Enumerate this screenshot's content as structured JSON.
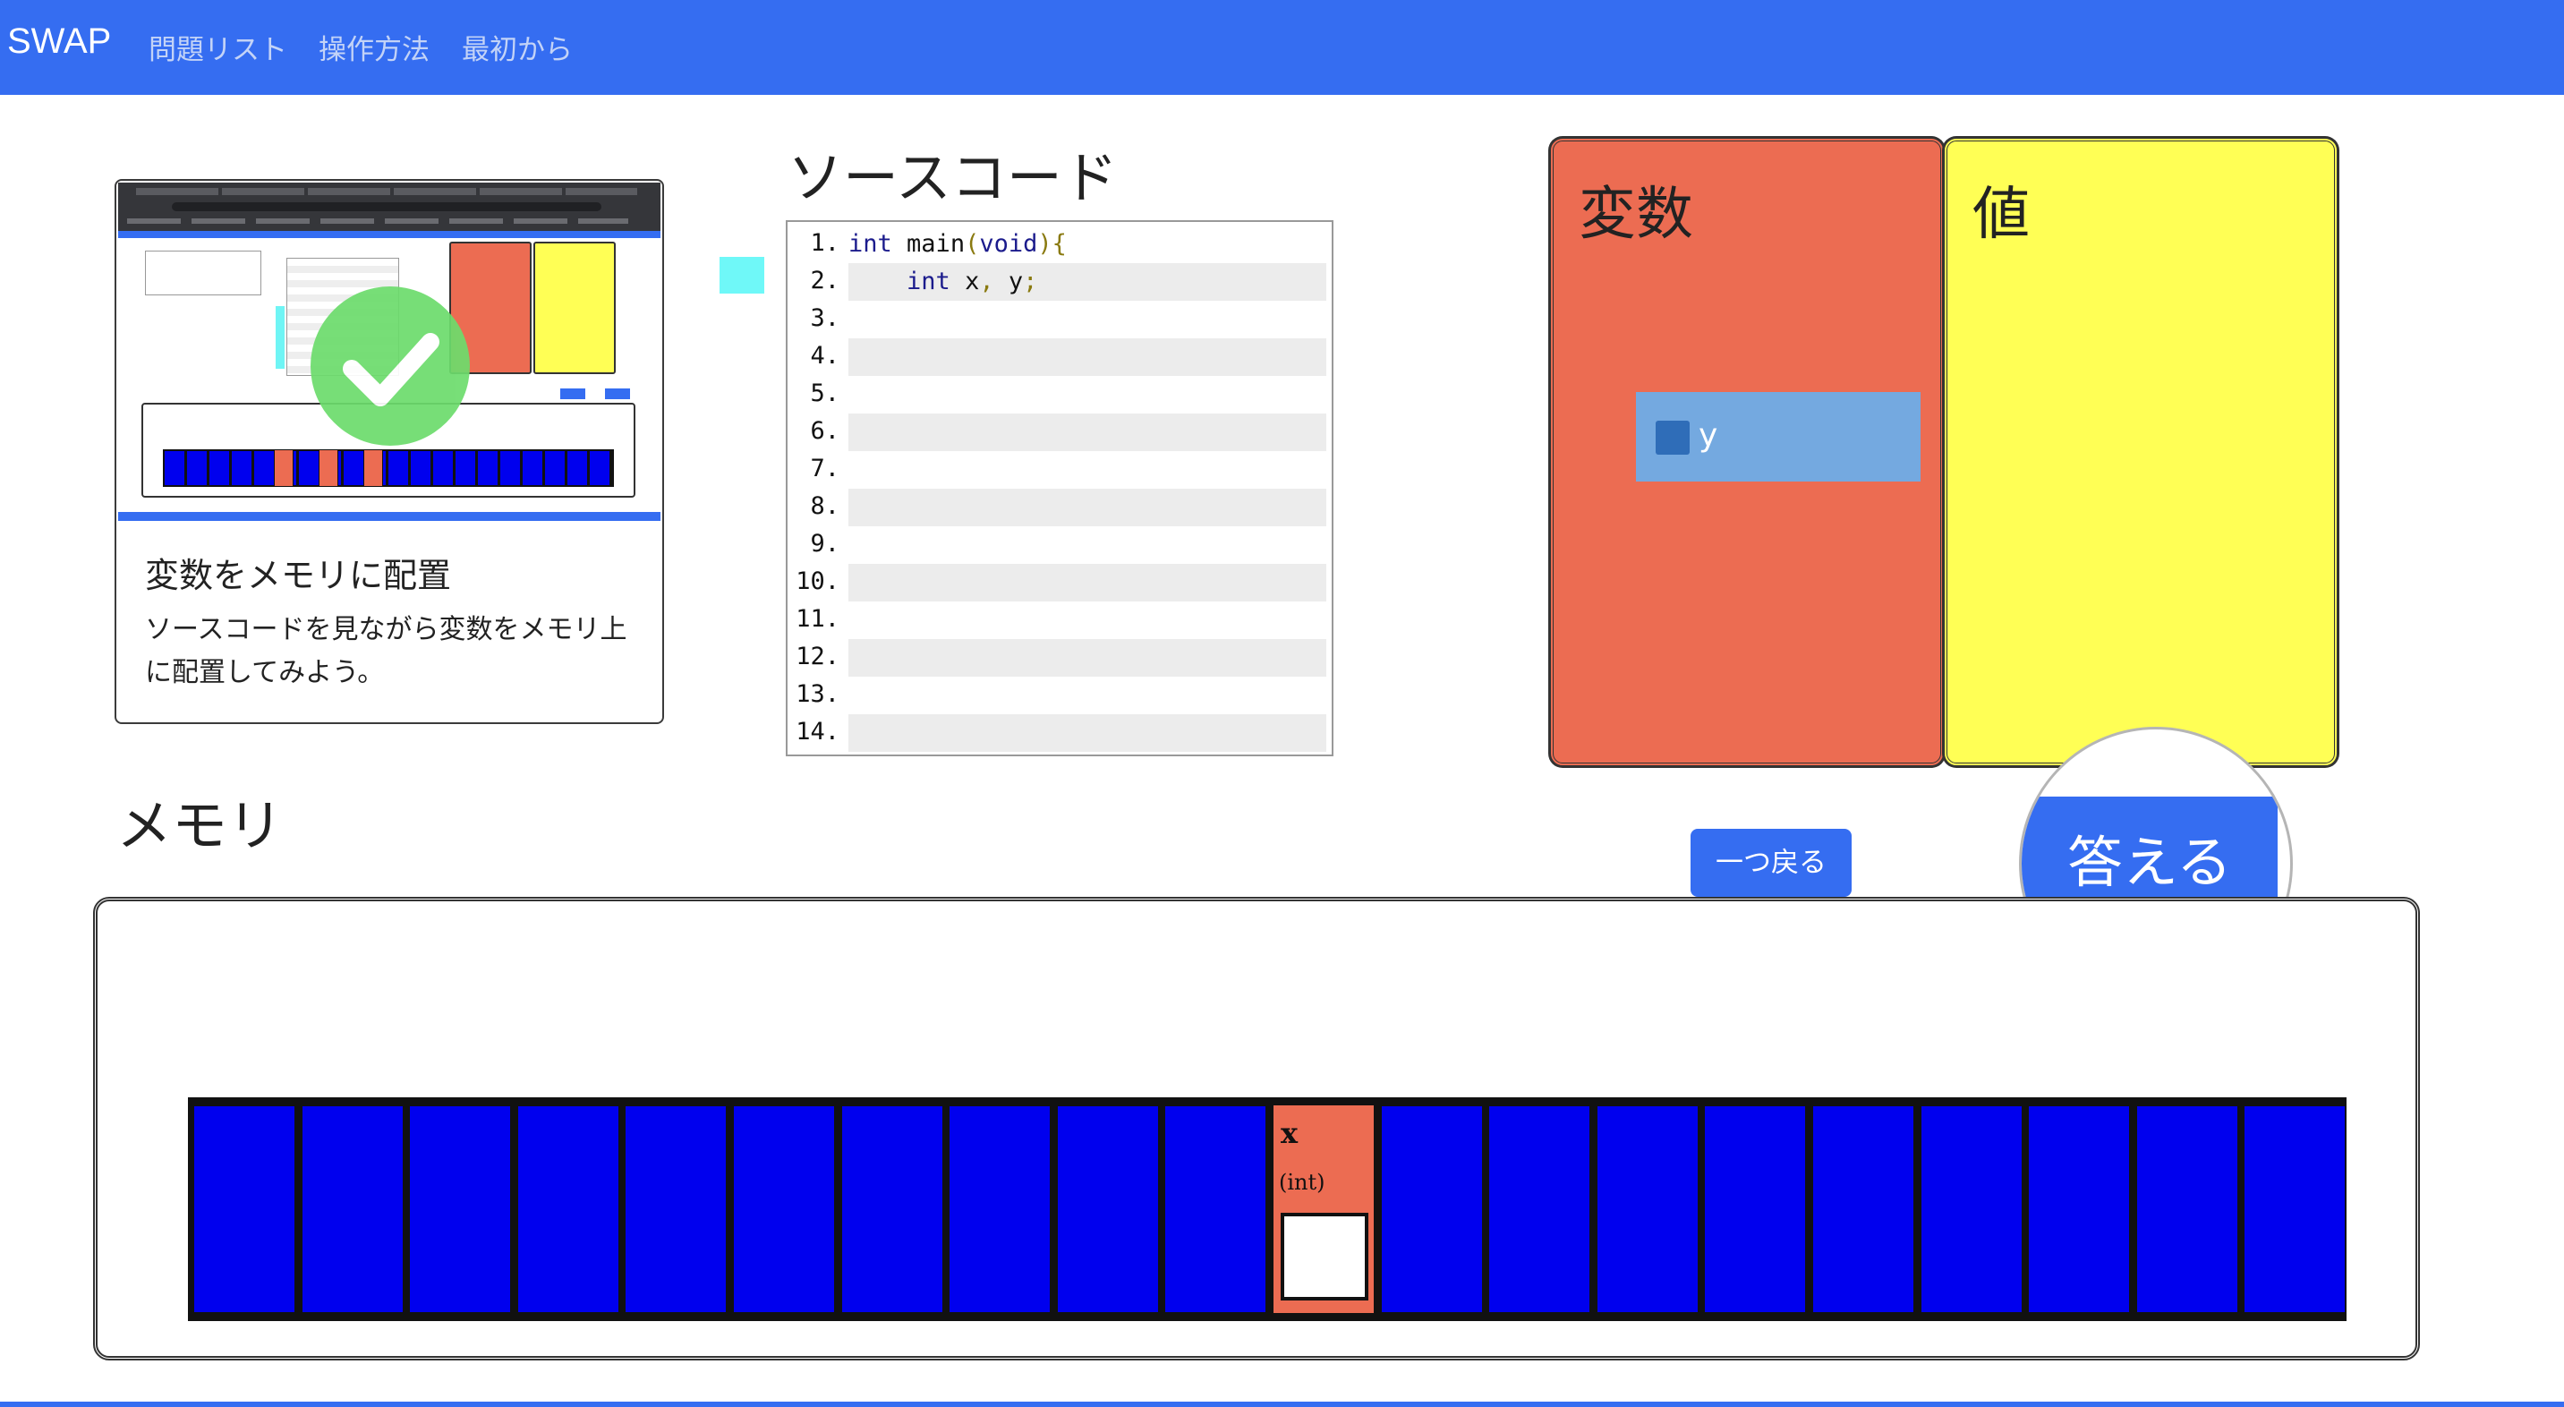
{
  "navbar": {
    "brand": "SWAP",
    "links": [
      "問題リスト",
      "操作方法",
      "最初から"
    ]
  },
  "tutorial_card": {
    "title": "変数をメモリに配置",
    "text": "ソースコードを見ながら変数をメモリ上に配置してみよう。",
    "thumbnail_icon": "checkmark-icon"
  },
  "source": {
    "title": "ソースコード",
    "lines": [
      {
        "num": "1.",
        "code": "int main(void){"
      },
      {
        "num": "2.",
        "code": "    int x, y;"
      },
      {
        "num": "3.",
        "code": ""
      },
      {
        "num": "4.",
        "code": ""
      },
      {
        "num": "5.",
        "code": ""
      },
      {
        "num": "6.",
        "code": ""
      },
      {
        "num": "7.",
        "code": ""
      },
      {
        "num": "8.",
        "code": ""
      },
      {
        "num": "9.",
        "code": ""
      },
      {
        "num": "10.",
        "code": ""
      },
      {
        "num": "11.",
        "code": ""
      },
      {
        "num": "12.",
        "code": ""
      },
      {
        "num": "13.",
        "code": ""
      },
      {
        "num": "14.",
        "code": ""
      }
    ]
  },
  "panels": {
    "variables_title": "変数",
    "values_title": "値",
    "variable_chip": "y"
  },
  "buttons": {
    "back": "一つ戻る",
    "answer": "答える"
  },
  "memory": {
    "title": "メモリ",
    "cell_count": 20,
    "placed_variable": {
      "index": 10,
      "name": "x",
      "type": "(int)",
      "value": ""
    }
  },
  "colors": {
    "accent": "#356df1",
    "variables_panel": "#ec6c52",
    "values_panel": "#ffff55",
    "memory_cell": "#0000ee",
    "variable_chip": "#74a9e0",
    "marker": "#6ff8f8"
  }
}
